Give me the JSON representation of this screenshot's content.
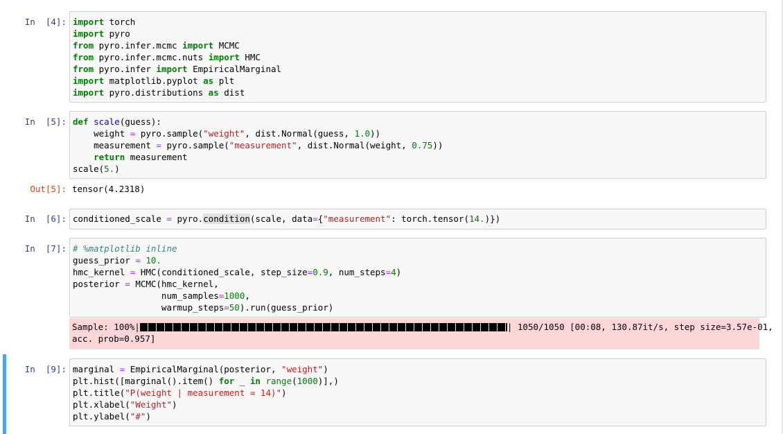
{
  "cells": {
    "c4": {
      "prompt": "In  [4]:",
      "lines": [
        "import torch",
        "import pyro",
        "from pyro.infer.mcmc import MCMC",
        "from pyro.infer.mcmc.nuts import HMC",
        "from pyro.infer import EmpiricalMarginal",
        "import matplotlib.pyplot as plt",
        "import pyro.distributions as dist"
      ]
    },
    "c5": {
      "prompt": "In  [5]:",
      "out_prompt": "Out[5]:",
      "output": "tensor(4.2318)"
    },
    "c6": {
      "prompt": "In  [6]:"
    },
    "c7": {
      "prompt": "In  [7]:",
      "stderr_line1_prefix": "Sample: 100%|",
      "stderr_line1_suffix": "| 1050/1050 [00:08, 130.87it/s, step size=3.57e-01,",
      "stderr_line2": "acc. prob=0.957]"
    },
    "c9": {
      "prompt": "In  [9]:"
    }
  },
  "colors": {
    "input_prompt": "#303f9f",
    "output_prompt": "#d84315",
    "keyword": "#008000",
    "string": "#ba2121",
    "stderr_bg": "#fdd7d7",
    "selected_border": "#42a5f5"
  }
}
